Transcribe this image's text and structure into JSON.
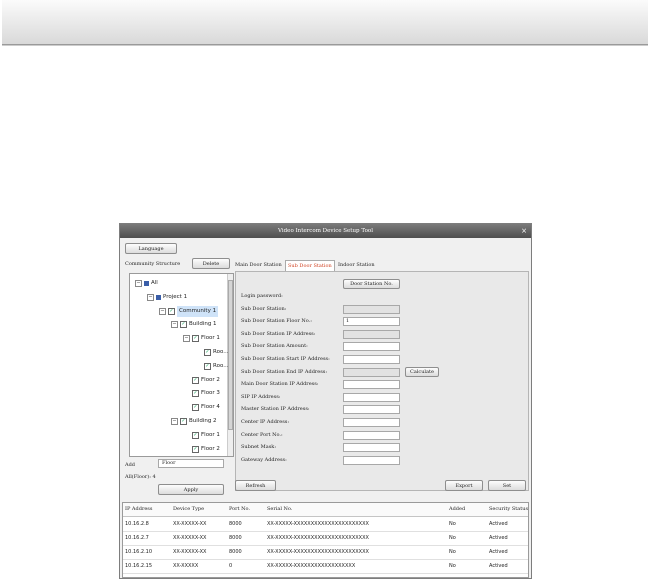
{
  "window": {
    "title": "Video Intercom Device Setup Tool",
    "close": "×"
  },
  "top": {
    "language": "Language"
  },
  "community": {
    "label": "Community Structure",
    "delete": "Delete"
  },
  "tree": [
    {
      "label": "All",
      "icon": "square",
      "exp": "−"
    },
    {
      "label": "Project 1",
      "icon": "square",
      "exp": "−"
    },
    {
      "label": "Community 1",
      "icon": "check",
      "exp": "−",
      "selected": true
    },
    {
      "label": "Building 1",
      "icon": "check",
      "exp": "−"
    },
    {
      "label": "Floor 1",
      "icon": "check",
      "exp": "−"
    },
    {
      "label": "Roo...",
      "icon": "check"
    },
    {
      "label": "Roo...",
      "icon": "check"
    },
    {
      "label": "Floor 2",
      "icon": "check"
    },
    {
      "label": "Floor 3",
      "icon": "check"
    },
    {
      "label": "Floor 4",
      "icon": "check"
    },
    {
      "label": "Building 2",
      "icon": "check",
      "exp": "−"
    },
    {
      "label": "Floor 1",
      "icon": "check"
    },
    {
      "label": "Floor 2",
      "icon": "check"
    }
  ],
  "add": {
    "label": "Add",
    "value": "Floor",
    "all_floor": "All(Floor): 4",
    "apply": "Apply"
  },
  "tabs": [
    "Main Door Station",
    "Sub Door Station",
    "Indoor Station"
  ],
  "form": {
    "door_station_no_btn": "Door Station No.",
    "labels": [
      "Login password:",
      "Sub Door Station:",
      "Sub Door Station Floor No.:",
      "Sub Door Station IP Address:",
      "Sub Door Station Amount:",
      "Sub Door Station Start IP Address:",
      "Sub Door Station End IP Address:",
      "Main Door Station IP Address:",
      "SIP IP Address:",
      "Master Station IP Address:",
      "Center IP Address:",
      "Center Port No.:",
      "Subnet Mask:",
      "Gateway Address:"
    ],
    "floor_value": "1",
    "calculate": "Calculate"
  },
  "buttons": {
    "refresh": "Refresh",
    "export": "Export",
    "set": "Set"
  },
  "table": {
    "columns": [
      "IP Address",
      "Device Type",
      "Port No.",
      "Serial No.",
      "Added",
      "Security Status"
    ],
    "rows": [
      [
        "10.16.2.8",
        "XX-XXXXX-XX",
        "8000",
        "XX-XXXXX-XXXXXXXXXXXXXXXXXXXXXX",
        "No",
        "Actived"
      ],
      [
        "10.16.2.7",
        "XX-XXXXX-XX",
        "8000",
        "XX-XXXXX-XXXXXXXXXXXXXXXXXXXXXX",
        "No",
        "Actived"
      ],
      [
        "10.16.2.10",
        "XX-XXXXX-XX",
        "8000",
        "XX-XXXXX-XXXXXXXXXXXXXXXXXXXXXX",
        "No",
        "Actived"
      ],
      [
        "10.16.2.15",
        "XX-XXXXX",
        "0",
        "XX-XXXXX-XXXXXXXXXXXXXXXXXX",
        "No",
        "Actived"
      ]
    ]
  }
}
